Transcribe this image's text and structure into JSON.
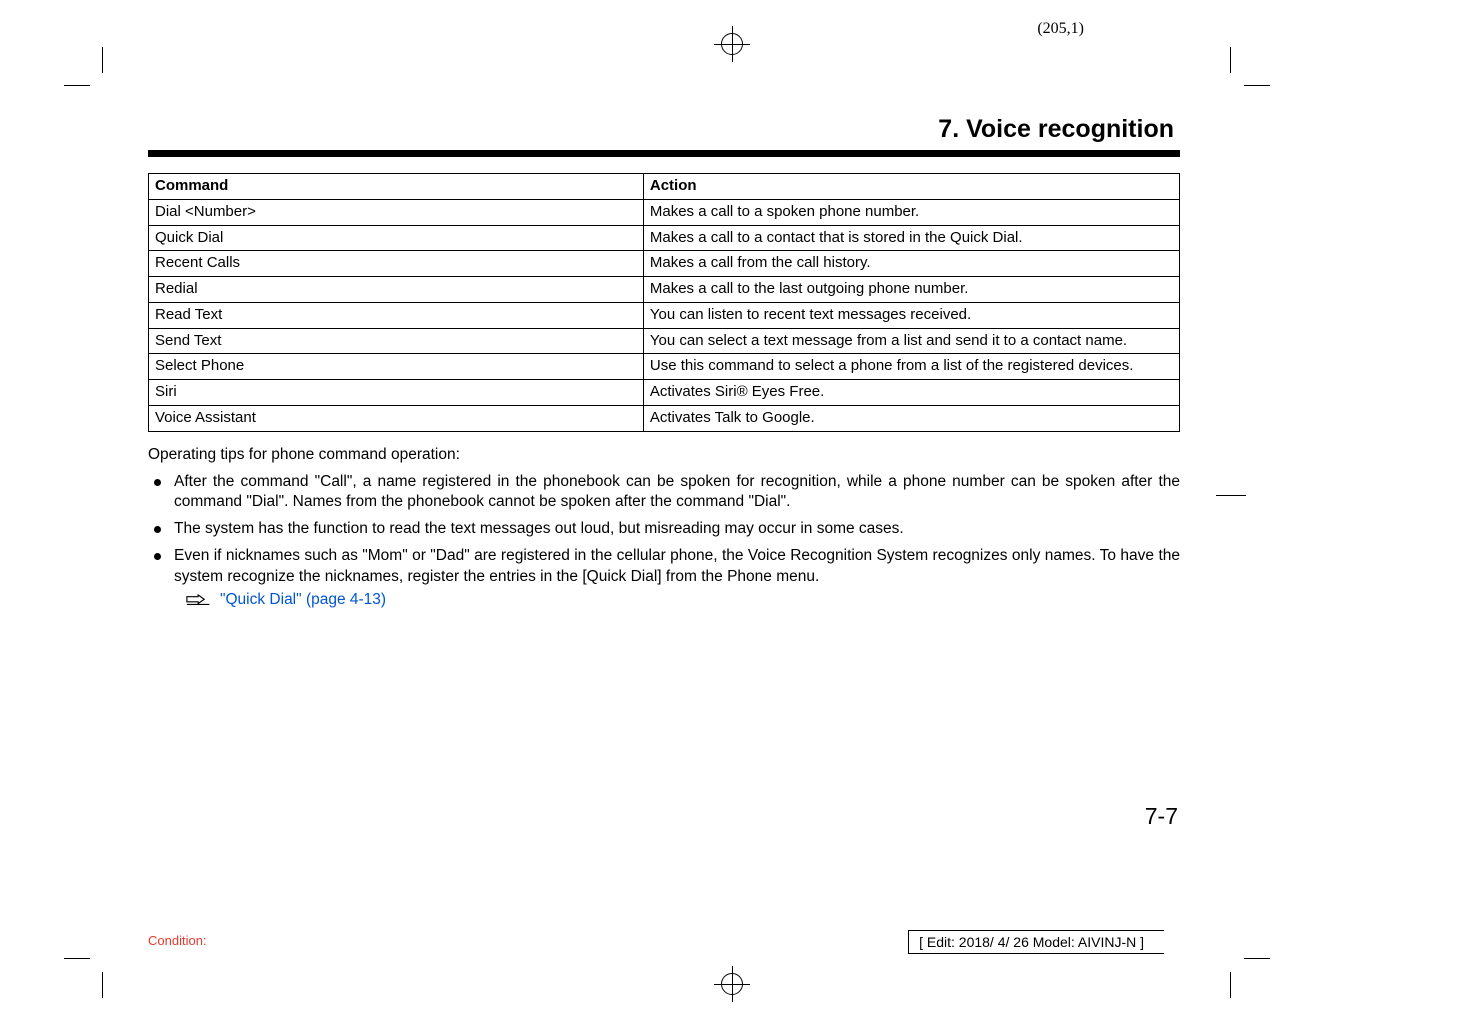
{
  "page_num_top": "(205,1)",
  "section_title": "7. Voice recognition",
  "table": {
    "headers": [
      "Command",
      "Action"
    ],
    "rows": [
      {
        "cmd": "Dial <Number>",
        "action": "Makes a call to a spoken phone number."
      },
      {
        "cmd": "Quick Dial",
        "action": "Makes a call to a contact that is stored in the Quick Dial."
      },
      {
        "cmd": "Recent Calls",
        "action": "Makes a call from the call history."
      },
      {
        "cmd": "Redial",
        "action": "Makes a call to the last outgoing phone number."
      },
      {
        "cmd": "Read Text",
        "action": "You can listen to recent text messages received."
      },
      {
        "cmd": "Send Text",
        "action": "You can select a text message from a list and send it to a contact name."
      },
      {
        "cmd": "Select Phone",
        "action": "Use this command to select a phone from a list of the registered devices."
      },
      {
        "cmd": "Siri",
        "action": "Activates Siri® Eyes Free."
      },
      {
        "cmd": "Voice Assistant",
        "action": "Activates Talk to Google."
      }
    ]
  },
  "tips_header": "Operating tips for phone command operation:",
  "bullets": [
    "After the command \"Call\", a name registered in the phonebook can be spoken for recognition, while a phone number can be spoken after the command \"Dial\". Names from the phonebook cannot be spoken after the command \"Dial\".",
    "The system has the function to read the text messages out loud, but misreading may occur in some cases.",
    "Even if nicknames such as \"Mom\" or \"Dad\" are registered in the cellular phone, the Voice Recognition System recognizes only names. To have the system recognize the nicknames, register the entries in the [Quick Dial] from the Phone menu."
  ],
  "cross_ref": "\"Quick Dial\" (page 4-13)",
  "page_num_bottom": "7-7",
  "condition_label": "Condition:",
  "edit_box": "[ Edit: 2018/ 4/ 26    Model: AIVINJ-N ]",
  "chart_data": {
    "type": "table",
    "title": "Voice recognition phone commands",
    "columns": [
      "Command",
      "Action"
    ],
    "rows": [
      [
        "Dial <Number>",
        "Makes a call to a spoken phone number."
      ],
      [
        "Quick Dial",
        "Makes a call to a contact that is stored in the Quick Dial."
      ],
      [
        "Recent Calls",
        "Makes a call from the call history."
      ],
      [
        "Redial",
        "Makes a call to the last outgoing phone number."
      ],
      [
        "Read Text",
        "You can listen to recent text messages received."
      ],
      [
        "Send Text",
        "You can select a text message from a list and send it to a contact name."
      ],
      [
        "Select Phone",
        "Use this command to select a phone from a list of the registered devices."
      ],
      [
        "Siri",
        "Activates Siri® Eyes Free."
      ],
      [
        "Voice Assistant",
        "Activates Talk to Google."
      ]
    ]
  }
}
